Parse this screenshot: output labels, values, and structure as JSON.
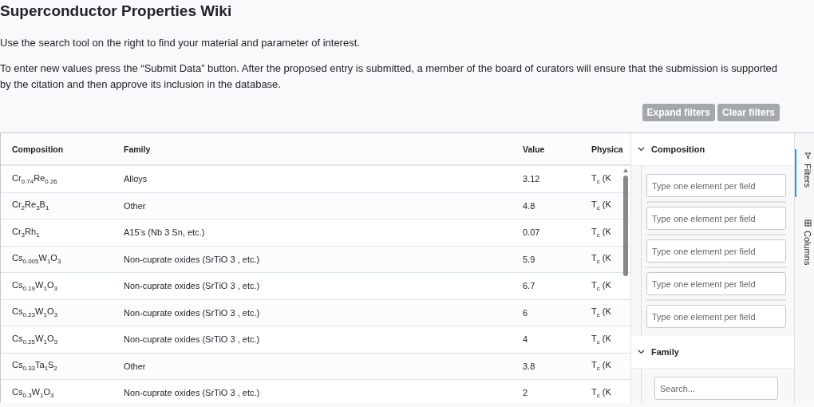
{
  "title": "Superconductor Properties Wiki",
  "intro": [
    "Use the search tool on the right to find your material and parameter of interest.",
    "To enter new values press the “Submit Data” button. After the proposed entry is submitted, a member of the board of curators will ensure that the submission is supported by the citation and then approve its inclusion in the database."
  ],
  "buttons": [
    "Expand filters",
    "Clear filters"
  ],
  "table": {
    "columns": [
      "Composition",
      "Family",
      "Value",
      "Physica"
    ],
    "rows": [
      [
        "Cr$_{0.74}$Re$_{0.26}$",
        "Alloys",
        "3.12",
        "T$_{c}$ (K"
      ],
      [
        "Cr$_{2}$Re$_{3}$B$_{1}$",
        "Other",
        "4.8",
        "T$_{c}$ (K"
      ],
      [
        "Cr$_{3}$Rh$_{1}$",
        "A15’s (Nb 3 Sn, etc.)",
        "0.07",
        "T$_{c}$ (K"
      ],
      [
        "Cs$_{0.005}$W$_{1}$O$_{3}$",
        "Non-cuprate oxides (SrTiO 3 , etc.)",
        "5.9",
        "T$_{c}$ (K"
      ],
      [
        "Cs$_{0.19}$W$_{1}$O$_{3}$",
        "Non-cuprate oxides (SrTiO 3 , etc.)",
        "6.7",
        "T$_{c}$ (K"
      ],
      [
        "Cs$_{0.23}$W$_{1}$O$_{3}$",
        "Non-cuprate oxides (SrTiO 3 , etc.)",
        "6",
        "T$_{c}$ (K"
      ],
      [
        "Cs$_{0.25}$W$_{1}$O$_{3}$",
        "Non-cuprate oxides (SrTiO 3 , etc.)",
        "4",
        "T$_{c}$ (K"
      ],
      [
        "Cs$_{0.33}$Ta$_{1}$S$_{2}$",
        "Other",
        "3.8",
        "T$_{c}$ (K"
      ],
      [
        "Cs$_{0.3}$W$_{1}$O$_{3}$",
        "Non-cuprate oxides (SrTiO 3 , etc.)",
        "2",
        "T$_{c}$ (K"
      ]
    ]
  },
  "filters": {
    "sections": [
      {
        "title": "Composition",
        "expanded": true,
        "kind": "fields",
        "fields": [
          {
            "placeholder": "Type one element per field"
          },
          {
            "placeholder": "Type one element per field"
          },
          {
            "placeholder": "Type one element per field"
          },
          {
            "placeholder": "Type one element per field"
          },
          {
            "placeholder": "Type one element per field"
          }
        ]
      },
      {
        "title": "Family",
        "expanded": true,
        "kind": "search",
        "placeholder": "Search..."
      }
    ]
  },
  "side_tabs": [
    {
      "label": "Filters",
      "selected": true
    },
    {
      "label": "Columns",
      "selected": false
    }
  ]
}
